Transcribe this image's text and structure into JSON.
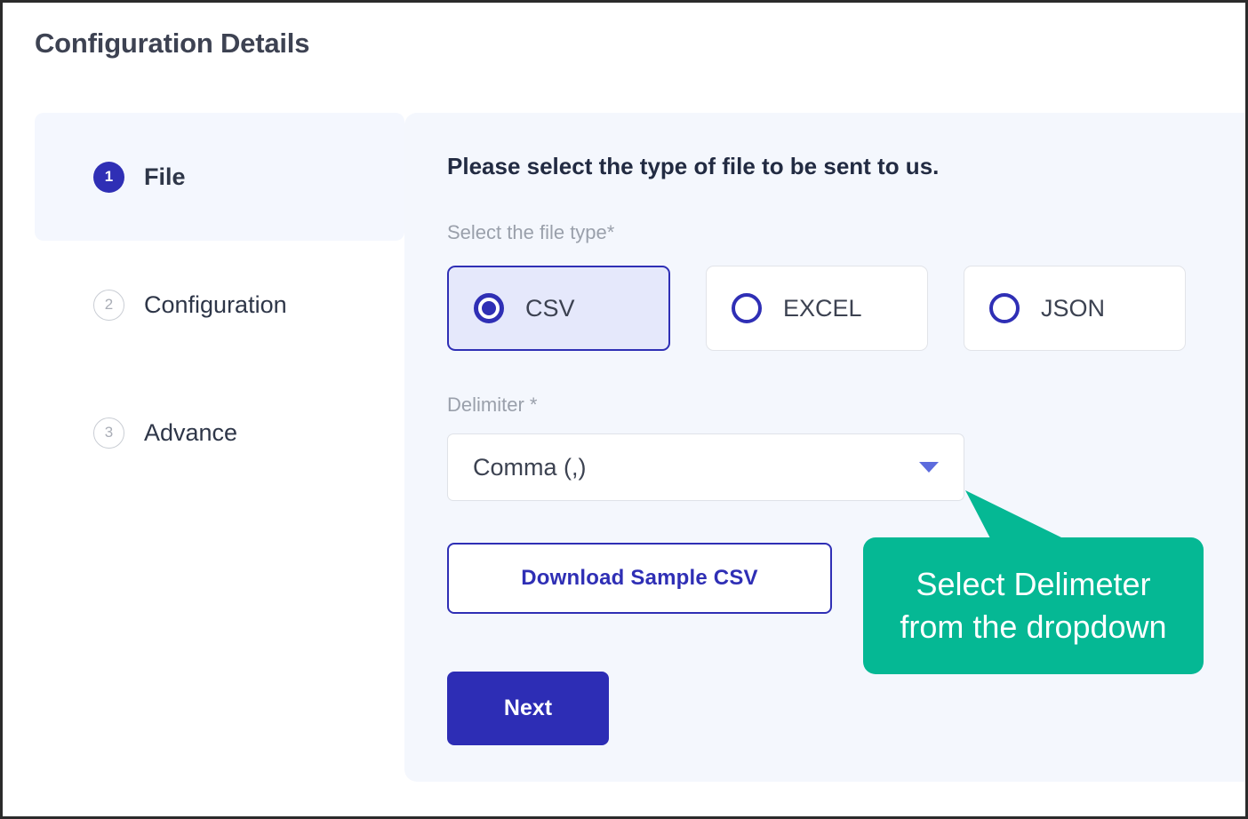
{
  "page": {
    "title": "Configuration Details"
  },
  "stepper": {
    "steps": [
      {
        "number": "1",
        "label": "File",
        "state": "active"
      },
      {
        "number": "2",
        "label": "Configuration",
        "state": "inactive"
      },
      {
        "number": "3",
        "label": "Advance",
        "state": "inactive"
      }
    ]
  },
  "panel": {
    "heading": "Please select the type of file to be sent to us.",
    "file_type": {
      "label": "Select the file type*",
      "options": [
        {
          "label": "CSV",
          "selected": true
        },
        {
          "label": "EXCEL",
          "selected": false
        },
        {
          "label": "JSON",
          "selected": false
        }
      ]
    },
    "delimiter": {
      "label": "Delimiter *",
      "value": "Comma (,)",
      "caret_icon": "chevron-down-icon"
    },
    "download_sample_label": "Download Sample CSV",
    "next_label": "Next"
  },
  "tooltip": {
    "line1": "Select Delimeter",
    "line2": "from the dropdown"
  },
  "colors": {
    "primary": "#2f2fb5",
    "next_button": "#2d2db5",
    "panel_background": "#f4f7fd",
    "active_step_background": "#f4f7fe",
    "selected_card_background": "#e5e8fb",
    "tooltip": "#05b894",
    "title_text": "#3d4252",
    "muted_label": "#9aa0ab",
    "caret": "#5c6bdd"
  }
}
